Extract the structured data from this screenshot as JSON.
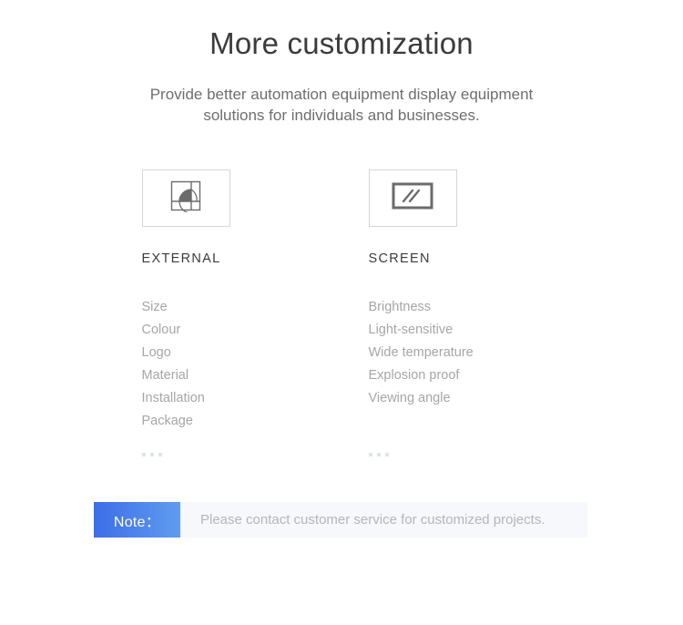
{
  "header": {
    "title": "More customization",
    "subtitle_line1": "Provide better automation equipment display equipment",
    "subtitle_line2": "solutions for individuals and businesses."
  },
  "columns": [
    {
      "icon_name": "external-shape-icon",
      "label": "EXTERNAL",
      "features": [
        "Size",
        "Colour",
        "Logo",
        "Material",
        "Installation",
        "Package"
      ],
      "more_indicator": "..."
    },
    {
      "icon_name": "screen-monitor-icon",
      "label": "SCREEN",
      "features": [
        "Brightness",
        "Light-sensitive",
        "Wide temperature",
        "Explosion proof",
        "Viewing angle"
      ],
      "more_indicator": "..."
    }
  ],
  "note": {
    "tag": "Note：",
    "text": "Please contact customer service for customized projects."
  },
  "colors": {
    "title": "#3b3b3b",
    "subtitle": "#6e6e6e",
    "feature": "#a6a6a6",
    "note_gradient_start": "#3d6ee6",
    "note_gradient_end": "#5f9cf0",
    "note_body_bg": "#f6f8fb",
    "icon_stroke": "#6b6b6b",
    "box_border": "#d6d6d6"
  }
}
